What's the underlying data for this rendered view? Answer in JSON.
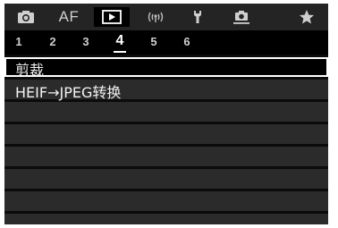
{
  "tabs": [
    {
      "name": "camera-icon"
    },
    {
      "label": "AF"
    },
    {
      "name": "playback-icon",
      "active": true
    },
    {
      "name": "wireless-icon"
    },
    {
      "name": "wrench-icon"
    },
    {
      "name": "custom-function-icon"
    },
    {
      "name": "star-icon"
    }
  ],
  "pages": [
    "1",
    "2",
    "3",
    "4",
    "5",
    "6"
  ],
  "active_page": "4",
  "menu": {
    "items": [
      {
        "label": "剪裁",
        "selected": true
      },
      {
        "label": "HEIF→JPEG转换"
      }
    ]
  },
  "colors": {
    "background": "#0b0b0b",
    "tab_bar": "#242424",
    "row": "#2b2b2b",
    "selection_border": "#ffffff"
  }
}
